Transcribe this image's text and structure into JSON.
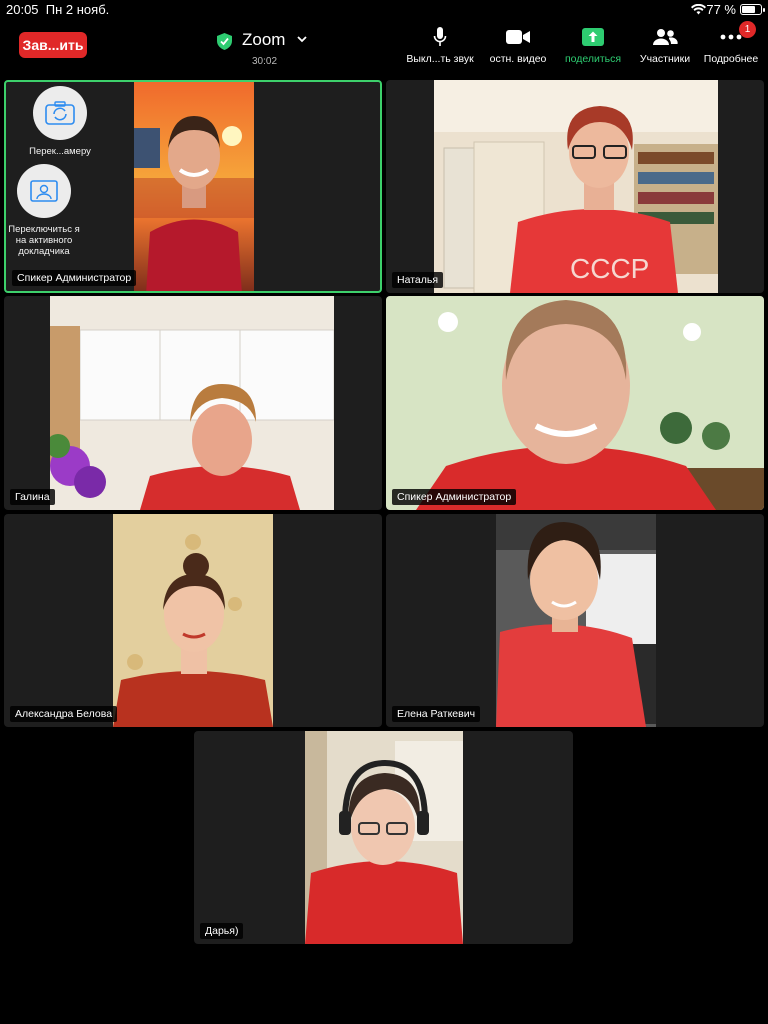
{
  "status": {
    "time": "20:05",
    "date": "Пн 2 нояб.",
    "battery_pct": "77 %",
    "battery_level": 0.77
  },
  "meeting": {
    "end_label": "Зав...ить",
    "app_title": "Zoom",
    "timer": "30:02"
  },
  "toolbar": {
    "mute_label": "Выкл...ть звук",
    "video_label": "остн. видео",
    "share_label": "поделиться",
    "participants_label": "Участники",
    "more_label": "Подробнее",
    "more_badge": "1"
  },
  "self_controls": {
    "switch_camera_label": "Перек...амеру",
    "switch_speaker_label": "Переключитьс я на активного докладчика"
  },
  "participants": [
    {
      "name": "Спикер Администратор"
    },
    {
      "name": "Наталья"
    },
    {
      "name": "Галина"
    },
    {
      "name": "Спикер Администратор"
    },
    {
      "name": "Александра Белова"
    },
    {
      "name": "Елена Раткевич"
    },
    {
      "name": "Дарья)"
    }
  ],
  "colors": {
    "accent_green": "#3dd06b",
    "end_red": "#e02828",
    "tile_bg": "#1e1e1e"
  }
}
